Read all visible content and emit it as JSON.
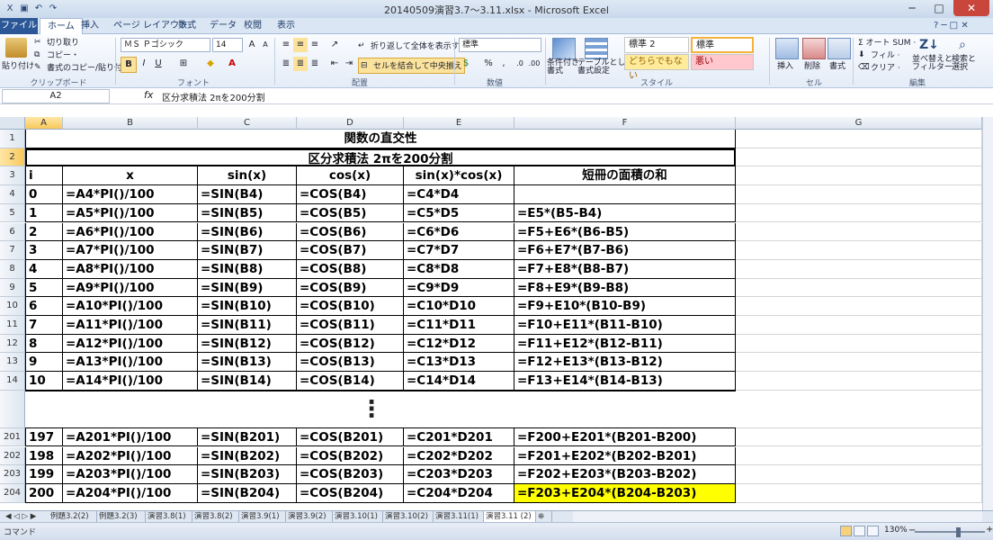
{
  "window": {
    "title": "20140509演習3.7～3.11.xlsx - Microsoft Excel",
    "minimize": "─",
    "maximize": "□",
    "close": "✕"
  },
  "tabs": [
    "ファイル",
    "ホーム",
    "挿入",
    "ページ レイアウト",
    "数式",
    "データ",
    "校閲",
    "表示"
  ],
  "ribbon": {
    "clipboard": {
      "paste": "貼り付け",
      "cut": "切り取り",
      "copy": "コピー・",
      "format_painter": "書式のコピー/貼り付け",
      "label": "クリップボード"
    },
    "font": {
      "name": "ＭＳ Ｐゴシック",
      "size": "14",
      "bold": "B",
      "italic": "I",
      "underline": "U",
      "label": "フォント"
    },
    "alignment": {
      "wrap": "折り返して全体を表示する",
      "merge": "セルを結合して中央揃え",
      "label": "配置"
    },
    "number": {
      "format": "標準",
      "percent": "%",
      "comma": ",",
      "label": "数値"
    },
    "styles": {
      "conditional": "条件付き\n書式",
      "table": "テーブルとして\n書式設定",
      "style1": "標準 2",
      "style2": "標準",
      "style3": "どちらでもない",
      "style4": "悪い",
      "label": "スタイル"
    },
    "cells": {
      "insert": "挿入",
      "delete": "削除",
      "format": "書式",
      "label": "セル"
    },
    "editing": {
      "autosum": "Σ オート SUM ·",
      "fill": "フィル ·",
      "clear": "クリア ·",
      "sort": "並べ替えと\nフィルター",
      "find": "検索と\n選択",
      "label": "編集"
    }
  },
  "formula_bar": {
    "name_box": "A2",
    "fx": "fx",
    "content": "区分求積法  2πを200分割"
  },
  "columns": [
    "A",
    "B",
    "C",
    "D",
    "E",
    "F",
    "G"
  ],
  "rows": [
    {
      "n": "1",
      "type": "title",
      "text": "関数の直交性"
    },
    {
      "n": "2",
      "type": "title",
      "text": "区分求積法  2πを200分割"
    },
    {
      "n": "3",
      "cells": [
        "i",
        "x",
        "sin(x)",
        "cos(x)",
        "sin(x)*cos(x)",
        "短冊の面積の和"
      ]
    },
    {
      "n": "4",
      "cells": [
        "0",
        "=A4*PI()/100",
        "=SIN(B4)",
        "=COS(B4)",
        "=C4*D4",
        ""
      ]
    },
    {
      "n": "5",
      "cells": [
        "1",
        "=A5*PI()/100",
        "=SIN(B5)",
        "=COS(B5)",
        "=C5*D5",
        "=E5*(B5-B4)"
      ]
    },
    {
      "n": "6",
      "cells": [
        "2",
        "=A6*PI()/100",
        "=SIN(B6)",
        "=COS(B6)",
        "=C6*D6",
        "=F5+E6*(B6-B5)"
      ]
    },
    {
      "n": "7",
      "cells": [
        "3",
        "=A7*PI()/100",
        "=SIN(B7)",
        "=COS(B7)",
        "=C7*D7",
        "=F6+E7*(B7-B6)"
      ]
    },
    {
      "n": "8",
      "cells": [
        "4",
        "=A8*PI()/100",
        "=SIN(B8)",
        "=COS(B8)",
        "=C8*D8",
        "=F7+E8*(B8-B7)"
      ]
    },
    {
      "n": "9",
      "cells": [
        "5",
        "=A9*PI()/100",
        "=SIN(B9)",
        "=COS(B9)",
        "=C9*D9",
        "=F8+E9*(B9-B8)"
      ]
    },
    {
      "n": "10",
      "cells": [
        "6",
        "=A10*PI()/100",
        "=SIN(B10)",
        "=COS(B10)",
        "=C10*D10",
        "=F9+E10*(B10-B9)"
      ]
    },
    {
      "n": "11",
      "cells": [
        "7",
        "=A11*PI()/100",
        "=SIN(B11)",
        "=COS(B11)",
        "=C11*D11",
        "=F10+E11*(B11-B10)"
      ]
    },
    {
      "n": "12",
      "cells": [
        "8",
        "=A12*PI()/100",
        "=SIN(B12)",
        "=COS(B12)",
        "=C12*D12",
        "=F11+E12*(B12-B11)"
      ]
    },
    {
      "n": "13",
      "cells": [
        "9",
        "=A13*PI()/100",
        "=SIN(B13)",
        "=COS(B13)",
        "=C13*D13",
        "=F12+E13*(B13-B12)"
      ]
    },
    {
      "n": "14",
      "cells": [
        "10",
        "=A14*PI()/100",
        "=SIN(B14)",
        "=COS(B14)",
        "=C14*D14",
        "=F13+E14*(B14-B13)"
      ]
    },
    {
      "n": "",
      "type": "gap",
      "text": "⋮"
    },
    {
      "n": "201",
      "cells": [
        "197",
        "=A201*PI()/100",
        "=SIN(B201)",
        "=COS(B201)",
        "=C201*D201",
        "=F200+E201*(B201-B200)"
      ]
    },
    {
      "n": "202",
      "cells": [
        "198",
        "=A202*PI()/100",
        "=SIN(B202)",
        "=COS(B202)",
        "=C202*D202",
        "=F201+E202*(B202-B201)"
      ]
    },
    {
      "n": "203",
      "cells": [
        "199",
        "=A203*PI()/100",
        "=SIN(B203)",
        "=COS(B203)",
        "=C203*D203",
        "=F202+E203*(B203-B202)"
      ]
    },
    {
      "n": "204",
      "cells": [
        "200",
        "=A204*PI()/100",
        "=SIN(B204)",
        "=COS(B204)",
        "=C204*D204",
        "=F203+E204*(B204-B203)"
      ],
      "highlight_last": true
    }
  ],
  "sheet_tabs": [
    "例題3.2(2)",
    "例題3.2(3)",
    "演習3.8(1)",
    "演習3.8(2)",
    "演習3.9(1)",
    "演習3.9(2)",
    "演習3.10(1)",
    "演習3.10(2)",
    "演習3.11(1)",
    "演習3.11 (2)"
  ],
  "active_sheet": "演習3.11 (2)",
  "status": {
    "mode": "コマンド",
    "zoom": "130%"
  },
  "colors": {
    "highlight": "#ffff00",
    "file_tab": "#2b5797",
    "selected_header": "#f7c85b"
  }
}
